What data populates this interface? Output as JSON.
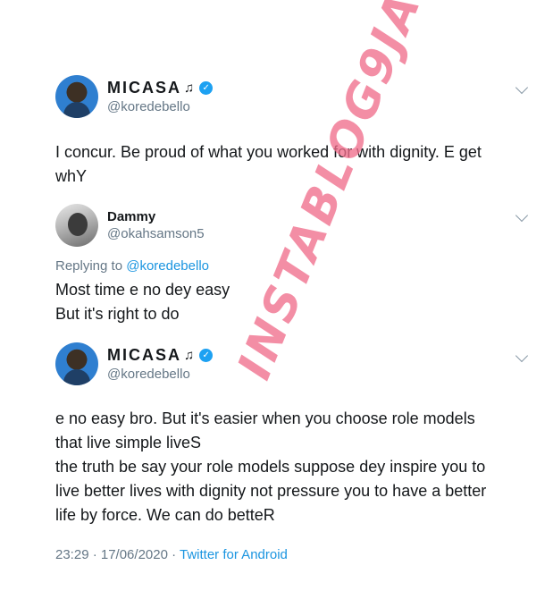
{
  "tweet1": {
    "display_name": "MICASA",
    "handle": "@koredebello",
    "text": "I concur. Be proud of what you worked for with dignity. E get\nwhY"
  },
  "reply": {
    "display_name": "Dammy",
    "handle": "@okahsamson5",
    "replying_prefix": "Replying to ",
    "replying_to": "@koredebello",
    "text": "Most time e no dey easy\nBut it's right to do"
  },
  "tweet2": {
    "display_name": "MICASA",
    "handle": "@koredebello",
    "text": "e no easy bro. But it's easier when you choose role models\nthat live  simple liveS\nthe truth be say your role models suppose dey inspire you to\nlive better lives with dignity not pressure you to have a better\nlife by force. We can do betteR",
    "timestamp": "23:29 · 17/06/2020 · ",
    "source": "Twitter for Android"
  },
  "watermark": "INSTABLOG9JA",
  "icons": {
    "music": "♫",
    "verified": "✓"
  },
  "colors": {
    "verified": "#1da1f2",
    "link": "#1b95e0",
    "secondary_text": "#657786",
    "watermark": "#f06e8c"
  }
}
